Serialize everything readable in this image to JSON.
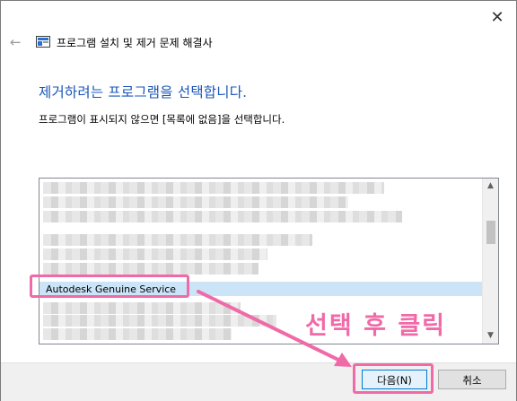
{
  "window": {
    "title": "프로그램 설치 및 제거 문제 해결사",
    "close_glyph": "✕",
    "back_glyph": "←"
  },
  "content": {
    "heading": "제거하려는 프로그램을 선택합니다.",
    "description": "프로그램이 표시되지 않으면 [목록에 없음]을 선택합니다."
  },
  "program_list": {
    "selected_item": "Autodesk Genuine Service",
    "blurred_item_count": 12
  },
  "annotation": {
    "text": "선택 후 클릭",
    "color": "#f06aa8"
  },
  "buttons": {
    "next_label": "다음(N)",
    "cancel_label": "취소"
  },
  "colors": {
    "heading": "#1a55b8",
    "selection": "#cce4f7",
    "accent_border": "#0078d7"
  }
}
